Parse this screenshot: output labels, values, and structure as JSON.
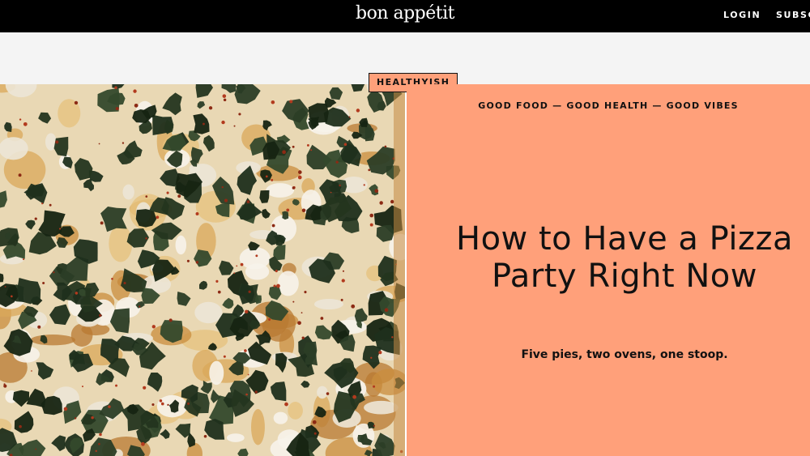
{
  "header": {
    "brand": "bon appétit",
    "login_label": "LOGIN",
    "subscribe_label": "SUBSCRIBE"
  },
  "hero": {
    "tag": "HEALTHYISH",
    "subhead": "GOOD FOOD — GOOD HEALTH — GOOD VIBES",
    "title": "How to Have a Pizza Party Right Now",
    "dek": "Five pies, two ovens, one stoop.",
    "image_icon": "pizza-photo"
  },
  "colors": {
    "header_bg": "#000000",
    "accent": "#ffa07a",
    "strip_bg": "#f4f4f4"
  }
}
